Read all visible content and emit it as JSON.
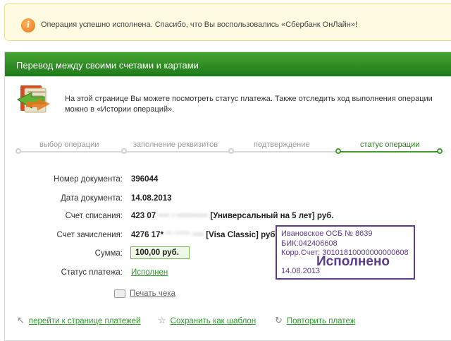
{
  "notice": {
    "icon": "info-icon",
    "text": "Операция успешно исполнена. Спасибо, что Вы воспользовались «Сбербанк ОнЛайн»!"
  },
  "panel": {
    "title": "Перевод между своими счетами и картами",
    "intro": "На этой странице Вы можете посмотреть статус платежа. Также отследить ход выполнения операции можно в «Истории операций»."
  },
  "steps": [
    {
      "label": "выбор операции",
      "active": false
    },
    {
      "label": "заполнение реквизитов",
      "active": false
    },
    {
      "label": "подтверждение",
      "active": false
    },
    {
      "label": "статус операции",
      "active": true
    }
  ],
  "fields": {
    "doc_number_label": "Номер документа:",
    "doc_number": "396044",
    "doc_date_label": "Дата документа:",
    "doc_date": "14.08.2013",
    "debit_label": "Счет списания:",
    "debit_account": "423 07",
    "debit_account_hidden": "•••• • •••••••••••",
    "debit_type": "[Универсальный на 5 лет]",
    "debit_currency": "руб.",
    "credit_label": "Счет зачисления:",
    "credit_card": "4276 17*",
    "credit_card_hidden": "** ***** ••••",
    "credit_type": "[Visa Classic]",
    "credit_currency": "руб.",
    "amount_label": "Сумма:",
    "amount": "100,00 руб.",
    "status_label": "Статус платежа:",
    "status": "Исполнен"
  },
  "stamp": {
    "line1": "Ивановское ОСБ № 8639",
    "line2": "БИК:042406608",
    "line3": "Корр.Счет: 30101810000000000608",
    "status": "Исполнено",
    "date": "14.08.2013"
  },
  "actions": {
    "print": "Печать чека",
    "back": "перейти к странице платежей",
    "save_template": "Сохранить как шаблон",
    "repeat": "Повторить платеж"
  },
  "colors": {
    "header_green": "#2f8a22",
    "link_green": "#2e9b2c",
    "stamp_purple": "#5e3b8c",
    "notice_bg": "#fffbe0"
  }
}
